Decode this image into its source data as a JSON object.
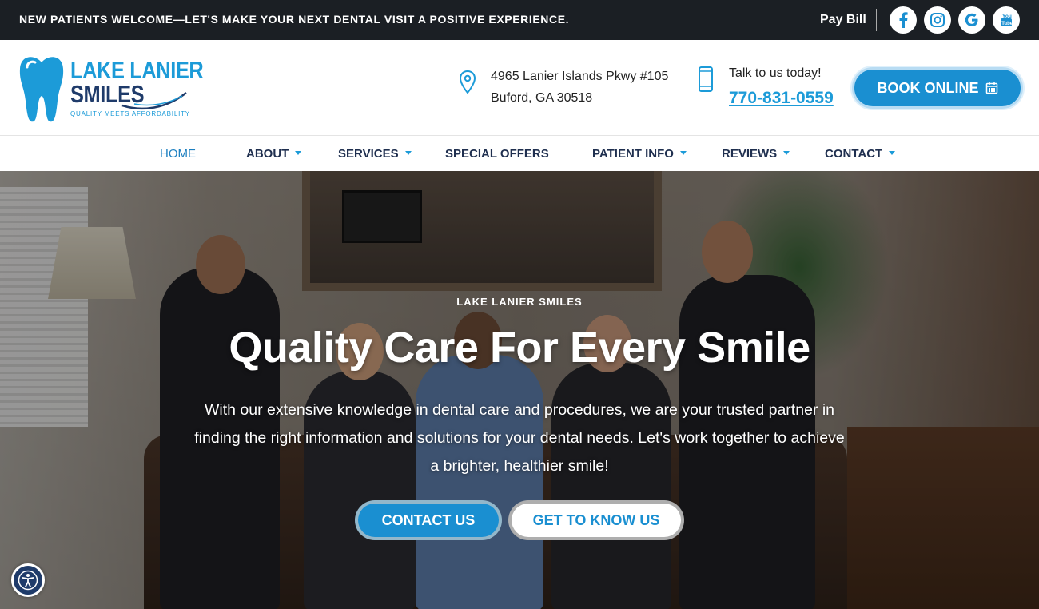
{
  "topbar": {
    "announcement": "NEW PATIENTS WELCOME—LET'S MAKE YOUR NEXT DENTAL VISIT A POSITIVE EXPERIENCE.",
    "pay_bill": "Pay Bill",
    "social": [
      "facebook-icon",
      "instagram-icon",
      "google-icon",
      "youtube-icon"
    ]
  },
  "logo": {
    "line1": "LAKE LANIER",
    "line2": "SMILES",
    "tagline": "QUALITY MEETS AFFORDABILITY"
  },
  "contact": {
    "address_line1": "4965 Lanier Islands Pkwy #105",
    "address_line2": "Buford, GA 30518",
    "talk": "Talk to us today!",
    "phone": "770-831-0559",
    "book": "BOOK ONLINE"
  },
  "nav": {
    "items": [
      {
        "label": "HOME",
        "dropdown": false
      },
      {
        "label": "ABOUT",
        "dropdown": true
      },
      {
        "label": "SERVICES",
        "dropdown": true
      },
      {
        "label": "SPECIAL OFFERS",
        "dropdown": false
      },
      {
        "label": "PATIENT INFO",
        "dropdown": true
      },
      {
        "label": "REVIEWS",
        "dropdown": true
      },
      {
        "label": "CONTACT",
        "dropdown": true
      }
    ]
  },
  "hero": {
    "kicker": "LAKE LANIER SMILES",
    "headline": "Quality Care For Every Smile",
    "subtext": "With our extensive knowledge in dental care and procedures, we are your trusted partner in finding the right information and solutions for your dental needs. Let's work together to achieve a brighter, healthier smile!",
    "btn_contact": "CONTACT US",
    "btn_know": "GET TO KNOW US"
  },
  "colors": {
    "brand_blue": "#1a8fd1",
    "brand_navy": "#1f3b6a",
    "topbar_bg": "#1b1f24"
  }
}
